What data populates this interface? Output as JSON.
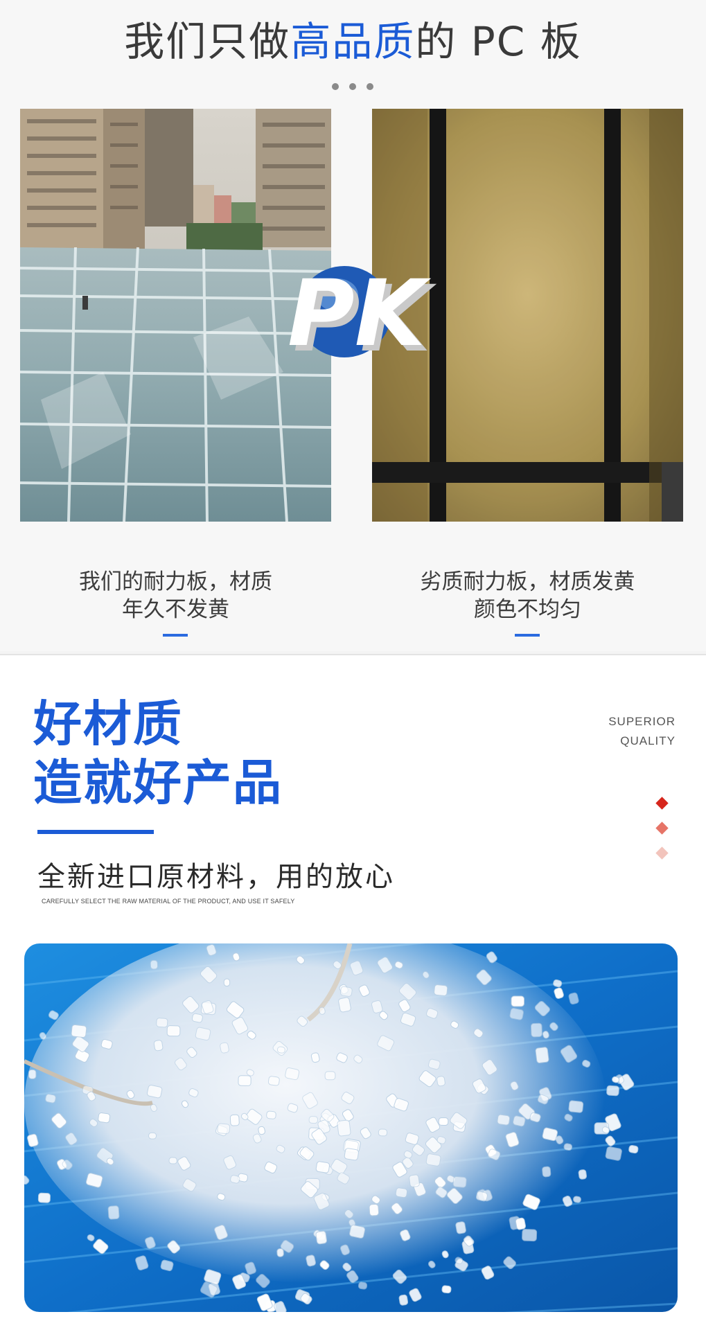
{
  "header": {
    "title_pre": "我们只做",
    "title_highlight": "高品质",
    "title_post": "的 PC 板"
  },
  "comparison": {
    "left_caption_line1": "我们的耐力板，材质",
    "left_caption_line2": "年久不发黄",
    "right_caption_line1": "劣质耐力板，材质发黄",
    "right_caption_line2": "颜色不均匀",
    "logo_text": "PK"
  },
  "quality_section": {
    "heading_line1": "好材质",
    "heading_line2": "造就好产品",
    "label_en_line1": "SUPERIOR",
    "label_en_line2": "QUALITY",
    "subline": "全新进口原材料，用的放心",
    "subline_en": "CAREFULLY SELECT THE RAW MATERIAL OF THE PRODUCT, AND USE IT SAFELY"
  },
  "colors": {
    "accent_blue": "#1b5bd6",
    "diamond_1": "#d6261c",
    "diamond_2": "#e67467",
    "diamond_3": "#f2c4bc"
  },
  "icons": [
    "pk-logo-icon",
    "diamond-icon"
  ]
}
